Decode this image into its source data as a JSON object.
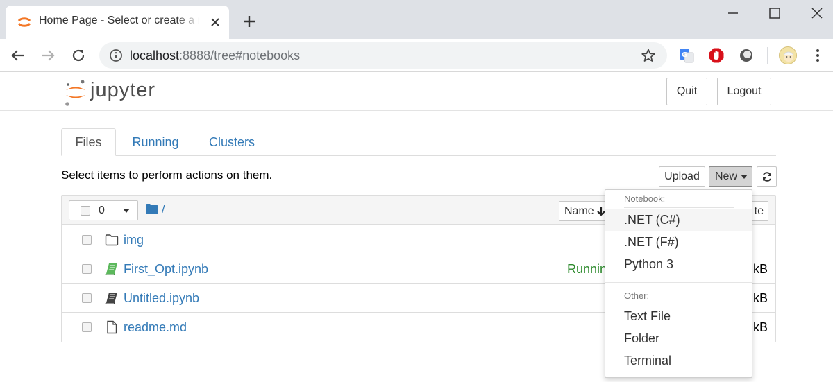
{
  "browser": {
    "tab_title": "Home Page - Select or create a notebook",
    "url_host": "localhost",
    "url_path": ":8888/tree#notebooks"
  },
  "jupyter": {
    "logo_text": "jupyter",
    "quit_label": "Quit",
    "logout_label": "Logout",
    "accent_color": "#f37726"
  },
  "tabs": [
    {
      "label": "Files",
      "active": true
    },
    {
      "label": "Running",
      "active": false
    },
    {
      "label": "Clusters",
      "active": false
    }
  ],
  "instructions": "Select items to perform actions on them.",
  "actions": {
    "upload_label": "Upload",
    "new_label": "New"
  },
  "list_header": {
    "selected_count": "0",
    "path": "/",
    "sort_label": "Name",
    "modified_label_partial": "te"
  },
  "files": [
    {
      "name": "img",
      "type": "folder",
      "status": "",
      "size": ""
    },
    {
      "name": "First_Opt.ipynb",
      "type": "notebook-running",
      "status": "Running",
      "size": "kB"
    },
    {
      "name": "Untitled.ipynb",
      "type": "notebook",
      "status": "",
      "size": "kB"
    },
    {
      "name": "readme.md",
      "type": "file",
      "status": "",
      "size": "kB"
    }
  ],
  "new_menu": {
    "notebook_header": "Notebook:",
    "notebook_items": [
      ".NET (C#)",
      ".NET (F#)",
      "Python 3"
    ],
    "other_header": "Other:",
    "other_items": [
      "Text File",
      "Folder",
      "Terminal"
    ]
  },
  "colors": {
    "link": "#337ab7",
    "running": "#2e8b2e",
    "notebook_running_icon": "#5cb85c"
  }
}
